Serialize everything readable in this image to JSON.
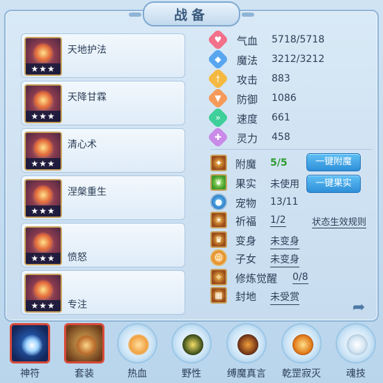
{
  "title": "战备",
  "skills": [
    {
      "name": "天地护法",
      "stars": "★★★"
    },
    {
      "name": "天降甘霖",
      "stars": "★★★"
    },
    {
      "name": "清心术",
      "stars": "★★★"
    },
    {
      "name": "涅槃重生",
      "stars": "★★★"
    },
    {
      "name": "愤怒",
      "stars": "★★★"
    },
    {
      "name": "专注",
      "stars": "★★★"
    }
  ],
  "stats": [
    {
      "label": "气血",
      "value": "5718/5718",
      "icon": "heart-icon",
      "color": "#f2708a"
    },
    {
      "label": "魔法",
      "value": "3212/3212",
      "icon": "mana-icon",
      "color": "#59a6f0"
    },
    {
      "label": "攻击",
      "value": "883",
      "icon": "attack-icon",
      "color": "#f5b942"
    },
    {
      "label": "防御",
      "value": "1086",
      "icon": "defense-icon",
      "color": "#f59a5a"
    },
    {
      "label": "速度",
      "value": "661",
      "icon": "speed-icon",
      "color": "#3ecf9a"
    },
    {
      "label": "灵力",
      "value": "458",
      "icon": "spirit-icon",
      "color": "#c98ae8"
    }
  ],
  "props": {
    "fumo": {
      "label": "附魔",
      "value": "5/5",
      "button": "一键附魔"
    },
    "guoshi": {
      "label": "果实",
      "value": "未使用",
      "button": "一键果实"
    },
    "chongwu": {
      "label": "宠物",
      "value": "13/11"
    },
    "qifu": {
      "label": "祈福",
      "value": "1/2",
      "link": "状态生效规则"
    },
    "bianshen": {
      "label": "变身",
      "value": "未变身"
    },
    "zinv": {
      "label": "子女",
      "value": "未变身"
    },
    "xiulian": {
      "label": "修炼觉醒",
      "value": "0/8"
    },
    "fengdi": {
      "label": "封地",
      "value": "未受赏"
    }
  },
  "tabs": [
    {
      "label": "神符",
      "icon": "rune-icon"
    },
    {
      "label": "套装",
      "icon": "armor-set-icon"
    },
    {
      "label": "热血",
      "icon": "hot-blood-icon"
    },
    {
      "label": "野性",
      "icon": "wild-icon"
    },
    {
      "label": "缚魔真言",
      "icon": "binding-icon"
    },
    {
      "label": "乾罡寂灭",
      "icon": "annihilation-icon"
    },
    {
      "label": "魂技",
      "icon": "soul-skill-icon"
    }
  ]
}
